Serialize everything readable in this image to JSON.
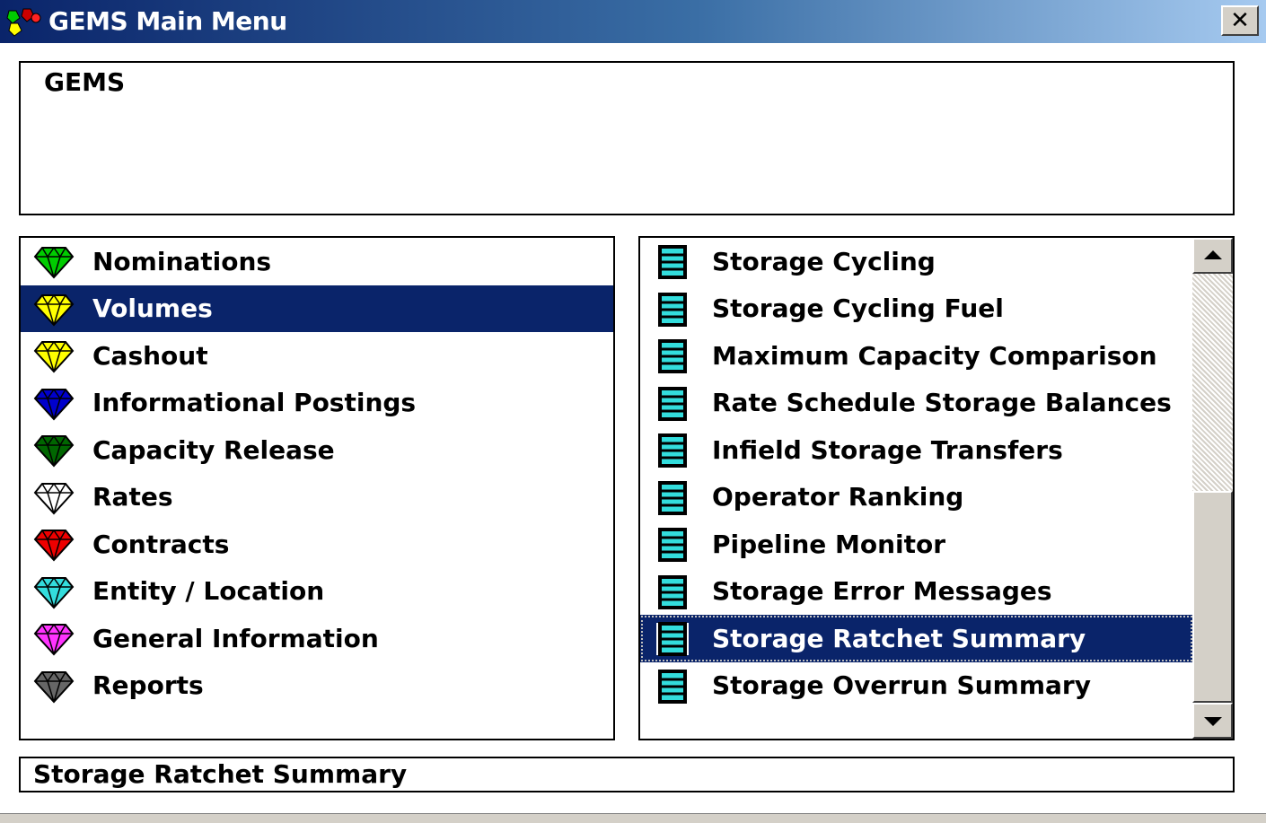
{
  "window": {
    "title": "GEMS Main Menu",
    "close_label": "✕",
    "icon": "gems-app-icon"
  },
  "header": {
    "text": "GEMS"
  },
  "categories": [
    {
      "label": "Nominations",
      "gem_color": "#00cc00",
      "selected": false
    },
    {
      "label": "Volumes",
      "gem_color": "#ffff00",
      "selected": true
    },
    {
      "label": "Cashout",
      "gem_color": "#ffff00",
      "selected": false
    },
    {
      "label": "Informational Postings",
      "gem_color": "#0000cc",
      "selected": false
    },
    {
      "label": "Capacity Release",
      "gem_color": "#006600",
      "selected": false
    },
    {
      "label": "Rates",
      "gem_color": "#ffffff",
      "selected": false
    },
    {
      "label": "Contracts",
      "gem_color": "#ee0000",
      "selected": false
    },
    {
      "label": "Entity / Location",
      "gem_color": "#33dddd",
      "selected": false
    },
    {
      "label": "General Information",
      "gem_color": "#ff33ff",
      "selected": false
    },
    {
      "label": "Reports",
      "gem_color": "#666666",
      "selected": false
    }
  ],
  "reports": [
    {
      "label": "Storage Cycling",
      "selected": false
    },
    {
      "label": "Storage Cycling Fuel",
      "selected": false
    },
    {
      "label": "Maximum Capacity Comparison",
      "selected": false
    },
    {
      "label": "Rate Schedule Storage Balances",
      "selected": false
    },
    {
      "label": "Infield Storage Transfers",
      "selected": false
    },
    {
      "label": "Operator Ranking",
      "selected": false
    },
    {
      "label": "Pipeline Monitor",
      "selected": false
    },
    {
      "label": "Storage Error Messages",
      "selected": false
    },
    {
      "label": "Storage Ratchet Summary",
      "selected": true
    },
    {
      "label": "Storage Overrun Summary",
      "selected": false
    }
  ],
  "report_icon": "report-window-icon",
  "status": {
    "text": "Storage Ratchet Summary"
  },
  "colors": {
    "selection": "#0a246a",
    "face": "#d4d0c8",
    "report_icon_fill": "#33dddd"
  }
}
